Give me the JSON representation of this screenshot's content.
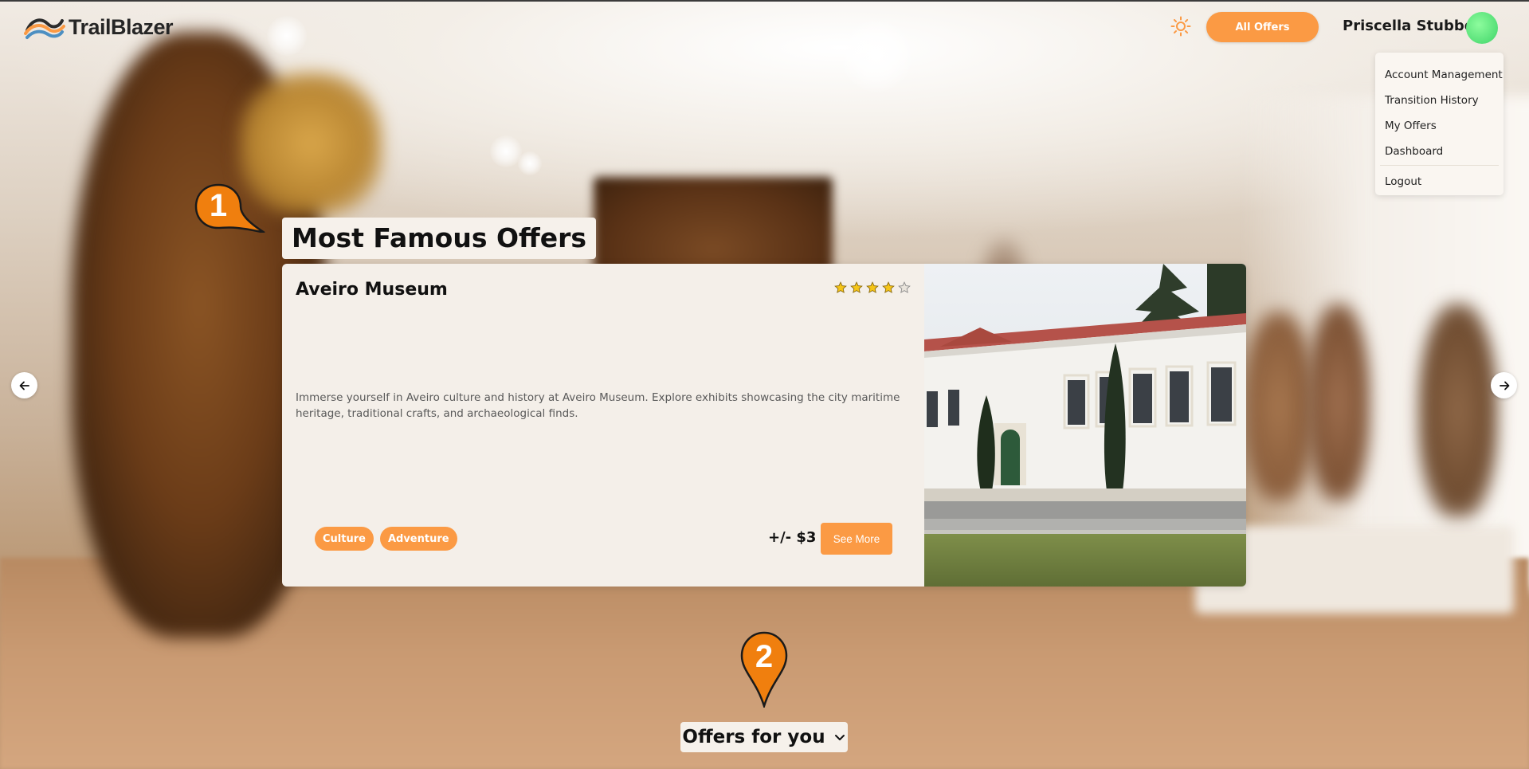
{
  "app": {
    "name": "TrailBlazer"
  },
  "header": {
    "all_offers_label": "All Offers",
    "user_name": "Priscella Stubbert"
  },
  "user_menu": {
    "items": [
      {
        "label": "Account Management"
      },
      {
        "label": "Transition History"
      },
      {
        "label": "My Offers"
      },
      {
        "label": "Dashboard"
      }
    ],
    "logout_label": "Logout"
  },
  "markers": {
    "first": "1",
    "second": "2"
  },
  "famous": {
    "title": "Most Famous Offers",
    "offer": {
      "name": "Aveiro Museum",
      "rating": 4,
      "max_rating": 5,
      "description": "Immerse yourself in Aveiro culture and history at Aveiro Museum. Explore exhibits showcasing the city maritime heritage, traditional crafts, and archaeological finds.",
      "tags": [
        "Culture",
        "Adventure"
      ],
      "price": "+/- $3",
      "cta": "See More"
    }
  },
  "offers_for_you": {
    "label": "Offers for you"
  },
  "icons": {
    "theme": "sun-icon",
    "prev": "arrow-left-icon",
    "next": "arrow-right-icon",
    "dropdown": "chevron-down-icon",
    "star": "star-icon"
  },
  "colors": {
    "accent": "#fb9a44",
    "star_filled": "#f5c518",
    "marker": "#f07f0e",
    "avatar": "#56e078"
  }
}
